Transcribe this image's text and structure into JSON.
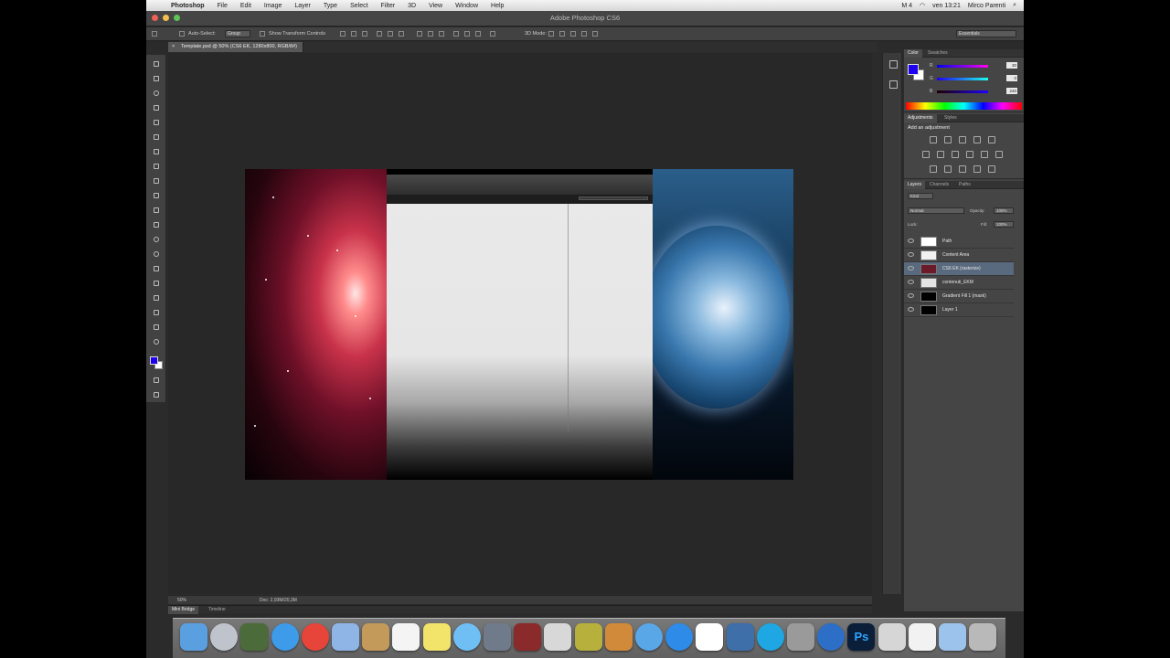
{
  "menubar": {
    "apple": "",
    "app_name": "Photoshop",
    "items": [
      "File",
      "Edit",
      "Image",
      "Layer",
      "Type",
      "Select",
      "Filter",
      "3D",
      "View",
      "Window",
      "Help"
    ],
    "status_right": [
      "M 4",
      "ven 13:21",
      "Mirco Parenti"
    ]
  },
  "window": {
    "title": "Adobe Photoshop CS6"
  },
  "options_bar": {
    "auto_select_label": "Auto-Select:",
    "auto_select_value": "Group",
    "transform_controls_label": "Show Transform Controls",
    "mode_3d_label": "3D Mode:",
    "workspace_value": "Essentials"
  },
  "document_tab": {
    "close": "×",
    "label": "Template.psd @ 50% (CS6 EK, 1280x800, RGB/8#)"
  },
  "status_bar": {
    "zoom": "50%",
    "doc_info": "Doc: 2,93M/20,3M"
  },
  "mini_bridge": {
    "tabs": [
      "Mini Bridge",
      "Timeline"
    ]
  },
  "panels": {
    "color": {
      "tabs": [
        "Color",
        "Swatches"
      ],
      "sliders": [
        {
          "label": "R",
          "value": "30",
          "gradient": "linear-gradient(to right,#0000f0,#ff00f0)"
        },
        {
          "label": "G",
          "value": "0",
          "gradient": "linear-gradient(to right,#1e00f0,#1effef)"
        },
        {
          "label": "B",
          "value": "240",
          "gradient": "linear-gradient(to right,#1e0000,#1e00ff)"
        }
      ]
    },
    "adjustments": {
      "tabs": [
        "Adjustments",
        "Styles"
      ],
      "add_label": "Add an adjustment"
    },
    "layers": {
      "tabs": [
        "Layers",
        "Channels",
        "Paths"
      ],
      "kind_filter": "Kind",
      "blend_mode": "Normal",
      "opacity_label": "Opacity:",
      "opacity_value": "100%",
      "lock_label": "Lock:",
      "fill_label": "Fill:",
      "fill_value": "100%",
      "rows": [
        {
          "name": "Path",
          "thumb": "#ffffff",
          "selected": false
        },
        {
          "name": "Content Area",
          "thumb": "#f2f2f2",
          "selected": false
        },
        {
          "name": "CS6 EK (rasterize)",
          "thumb": "#6b1a2a",
          "selected": true
        },
        {
          "name": "contenuti_EKM",
          "thumb": "#e4e4e4",
          "selected": false
        },
        {
          "name": "Gradient Fill 1 (mask)",
          "thumb": "#000000",
          "selected": false
        },
        {
          "name": "Layer 1",
          "thumb": "#000000",
          "selected": false
        }
      ]
    }
  },
  "colors": {
    "foreground": "#1e00f0",
    "background": "#ffffff",
    "canvas_bg": "#282828",
    "panel_bg": "#424242"
  },
  "dock": {
    "apps": [
      {
        "name": "finder-app",
        "color": "#5a9fe0",
        "round": false
      },
      {
        "name": "launchpad-app",
        "color": "#bfc4cc",
        "round": true
      },
      {
        "name": "mission-control-app",
        "color": "#4c6b3a",
        "round": false
      },
      {
        "name": "safari-app",
        "color": "#3d9be9",
        "round": true
      },
      {
        "name": "chrome-app",
        "color": "#e7443a",
        "round": true
      },
      {
        "name": "mail-app",
        "color": "#8fb4e6",
        "round": false
      },
      {
        "name": "contacts-app",
        "color": "#c49a5a",
        "round": false
      },
      {
        "name": "calendar-app",
        "color": "#f4f4f4",
        "round": false
      },
      {
        "name": "notes-app",
        "color": "#f2e36a",
        "round": false
      },
      {
        "name": "messages-app",
        "color": "#6fbff5",
        "round": true
      },
      {
        "name": "facetime-app",
        "color": "#6f7b8a",
        "round": false
      },
      {
        "name": "photo-booth-app",
        "color": "#8b2a2a",
        "round": false
      },
      {
        "name": "photos-app",
        "color": "#d8d8d8",
        "round": false
      },
      {
        "name": "imovie-app",
        "color": "#b8b03c",
        "round": false
      },
      {
        "name": "garageband-app",
        "color": "#d08a3a",
        "round": false
      },
      {
        "name": "itunes-app",
        "color": "#5aa7e8",
        "round": true
      },
      {
        "name": "app-store-app",
        "color": "#2f8be8",
        "round": true
      },
      {
        "name": "calendar2-app",
        "color": "#ffffff",
        "round": false
      },
      {
        "name": "preview-app",
        "color": "#3e6fa8",
        "round": false
      },
      {
        "name": "skype-app",
        "color": "#1ea7e3",
        "round": true
      },
      {
        "name": "system-preferences-app",
        "color": "#9a9a9a",
        "round": false
      },
      {
        "name": "utility-app",
        "color": "#2d6fc7",
        "round": true
      },
      {
        "name": "photoshop-app",
        "color": "#0b1f3a",
        "round": false,
        "label": "Ps"
      },
      {
        "name": "preview2-app",
        "color": "#d6d6d6",
        "round": false
      },
      {
        "name": "downloads-stack",
        "color": "#f2f2f2",
        "round": false
      },
      {
        "name": "folder-stack",
        "color": "#9cc3ec",
        "round": false
      },
      {
        "name": "trash",
        "color": "#b9b9b9",
        "round": false
      }
    ]
  }
}
